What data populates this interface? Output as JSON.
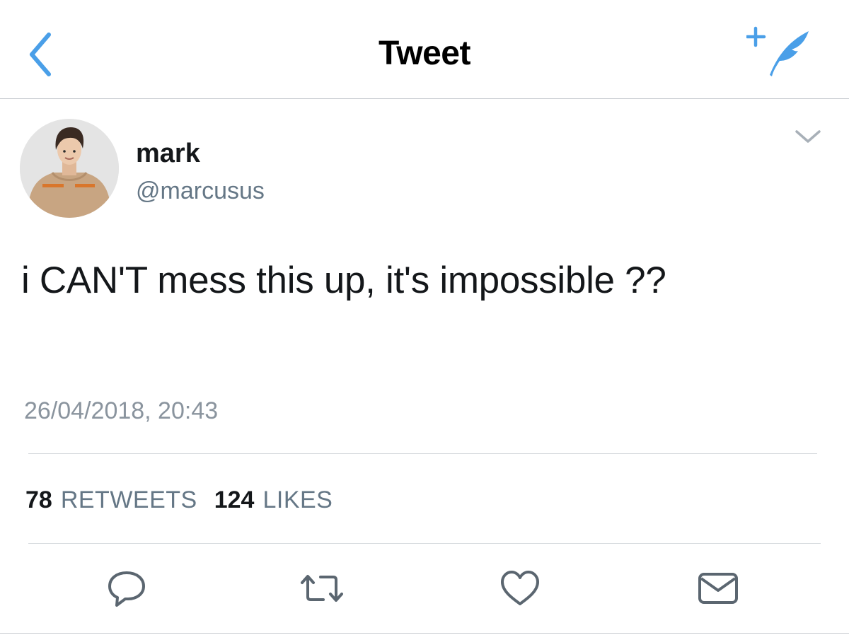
{
  "header": {
    "title": "Tweet",
    "back_icon": "chevron-left-icon",
    "compose_icon": "compose-tweet-icon"
  },
  "tweet": {
    "author": {
      "display_name": "mark",
      "handle": "@marcusus"
    },
    "text": "i CAN'T mess this up, it's impossible ??",
    "timestamp": "26/04/2018, 20:43",
    "stats": {
      "retweets_count": "78",
      "retweets_label": "RETWEETS",
      "likes_count": "124",
      "likes_label": "LIKES"
    },
    "actions": [
      "reply-icon",
      "retweet-icon",
      "like-icon",
      "direct-message-icon"
    ]
  },
  "colors": {
    "accent": "#4a9fe8",
    "text_primary": "#14171a",
    "text_secondary": "#657786",
    "icon_gray": "#5b6670",
    "divider": "#d6dadd"
  }
}
